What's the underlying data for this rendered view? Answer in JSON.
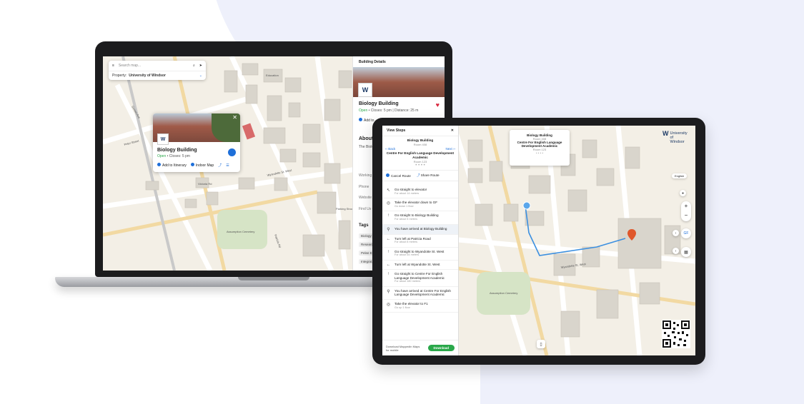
{
  "laptop": {
    "search": {
      "placeholder": "Search map...",
      "property_label": "Property:",
      "property_value": "University of Windsor"
    },
    "map_labels": [
      "Education",
      "Assumption Cemetery",
      "Wyandotte St. West",
      "Patricia Rd",
      "Sunset Ave",
      "Peter Street",
      "Victoria Rd",
      "Parking Structure"
    ],
    "popup": {
      "title": "Biology Building",
      "open": "Open",
      "closes": " • Closes: 5 pm",
      "add_itinerary": "Add to Itinerary",
      "indoor_map": "Indoor Map"
    },
    "details": {
      "header": "Building Details",
      "title": "Biology Building",
      "open": "Open",
      "status": " • Closes: 5 pm  |  Distance: 25 m",
      "add": "Add to",
      "about": "About",
      "desc": "The Biolo... square m... We have ... support o...",
      "fields": [
        "Working",
        "Phone",
        "Website",
        "Find Us O..."
      ],
      "tags_title": "Tags",
      "tags": [
        "Biology",
        "Research",
        "Pelee E...",
        "Integrat..."
      ]
    }
  },
  "tablet": {
    "steps": {
      "title": "View Steps",
      "dest_name": "Biology Building",
      "dest_room": "Room 408",
      "to_name": "Centre For English Language Development Academic",
      "to_room": "Room 123",
      "back": "Back",
      "next": "Next",
      "cancel": "Cancel Route",
      "share": "Share Route",
      "list": [
        {
          "icon": "↖",
          "text": "Go straight to elevator",
          "sub": "For about 14 meters"
        },
        {
          "icon": "◎",
          "text": "Take the elevator down to GF",
          "sub": "Go down 1 floor"
        },
        {
          "icon": "↑",
          "text": "Go straight to Biology Building",
          "sub": "For about 5 meters"
        },
        {
          "icon": "⚲",
          "text": "You have arrived at Biology Building",
          "sub": ""
        },
        {
          "icon": "←",
          "text": "Turn left at Patricia Road",
          "sub": "For about 8 meters"
        },
        {
          "icon": "↑",
          "text": "Go straight to Wyandotte St. West",
          "sub": "For about 54 meters"
        },
        {
          "icon": "←",
          "text": "Turn left at Wyandotte St. West",
          "sub": ""
        },
        {
          "icon": "↑",
          "text": "Go straight to Centre For English Language Development Academic",
          "sub": "For about 180 meters"
        },
        {
          "icon": "⚲",
          "text": "You have arrived at Centre For English Language Development Academic",
          "sub": ""
        },
        {
          "icon": "◎",
          "text": "Take the elevator to F1",
          "sub": "Go up 1 floor"
        }
      ],
      "foot_text": "Download Mappedin Maps for mobile",
      "download": "Download"
    },
    "card": {
      "from_name": "Biology Building",
      "from_room": "Room 408",
      "to_name": "Centre For English Language Development Academic",
      "to_room": "Room 123"
    },
    "brand": "University of Windsor",
    "lang": "English",
    "gf": "GF",
    "map_labels": [
      "Assumption Cemetery",
      "Wyandotte St. West"
    ]
  },
  "colors": {
    "accent": "#1e6fd9",
    "route": "#3b8fe0",
    "pin": "#e0572b",
    "open": "#2aa84a",
    "heart": "#d9263c",
    "background_tint": "#eef0fb"
  }
}
